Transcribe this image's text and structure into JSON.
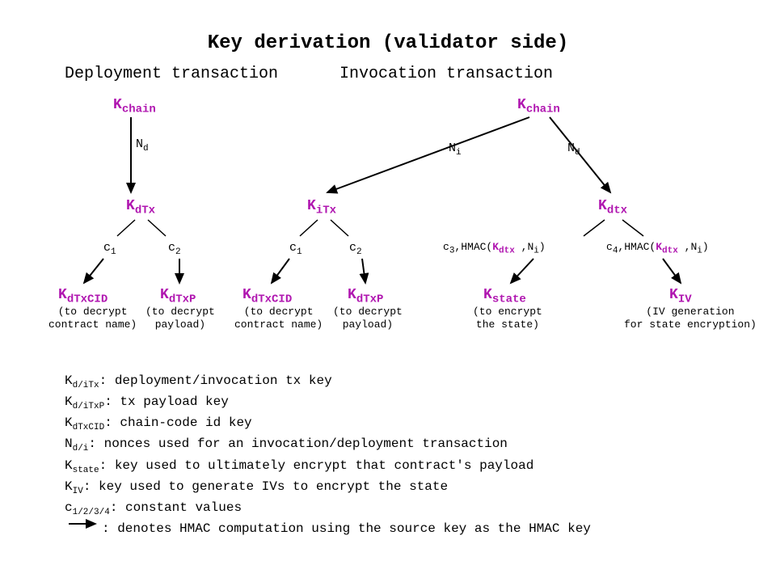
{
  "title": "Key derivation (validator side)",
  "subtitle_deploy": "Deployment transaction",
  "subtitle_invoke": "Invocation transaction",
  "K": "K",
  "sub_chain": "chain",
  "sub_dTx": "dTx",
  "sub_iTx": "iTx",
  "sub_dtx": "dtx",
  "sub_dTxCID": "dTxCID",
  "sub_dTxP": "dTxP",
  "sub_state": "state",
  "sub_IV": "IV",
  "N": "N",
  "sub_d": "d",
  "sub_i": "i",
  "c": "c",
  "sub_1": "1",
  "sub_2": "2",
  "sub_3": "3",
  "sub_4": "4",
  "comma_HMAC_open": ",HMAC(",
  "comma": ",",
  "close_paren": ")",
  "desc_dTxCID_1": "(to decrypt",
  "desc_dTxCID_2": "contract name)",
  "desc_dTxP_1": "(to decrypt",
  "desc_dTxP_2": "payload)",
  "desc_state_1": "(to encrypt",
  "desc_state_2": "the state)",
  "desc_IV_1": "(IV generation",
  "desc_IV_2": "for state encryption)",
  "legend_diTx_sub": "d/iTx",
  "legend_diTx": ": deployment/invocation tx key",
  "legend_diTxP_sub": "d/iTxP",
  "legend_diTxP": ": tx payload key",
  "legend_dTxCID_sub": "dTxCID",
  "legend_dTxCID": ": chain-code id key",
  "legend_Ndi_sub": "d/i",
  "legend_Ndi": ": nonces used for an invocation/deployment transaction",
  "legend_Kstate_sub": "state",
  "legend_Kstate": ": key used to ultimately encrypt that contract's payload",
  "legend_KIV_sub": "IV",
  "legend_KIV": ": key used to generate IVs to encrypt the state",
  "legend_c_sub": "1/2/3/4",
  "legend_c": ": constant values",
  "legend_arrow": ": denotes HMAC computation using the source key as the HMAC key",
  "arrow": "→"
}
